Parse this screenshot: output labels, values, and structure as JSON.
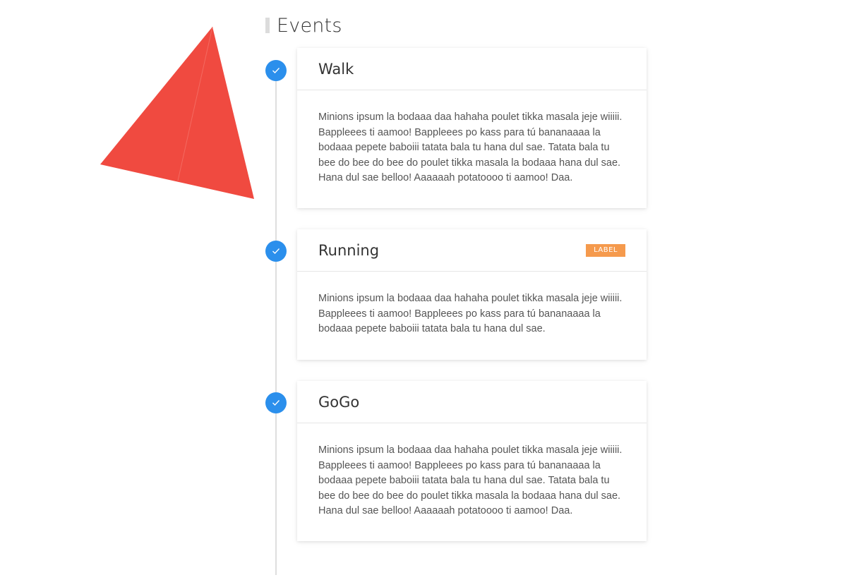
{
  "page": {
    "heading": "Events"
  },
  "colors": {
    "accent": "#2b8fec",
    "label": "#f59a4d",
    "triangle": "#f04a40",
    "timeline": "#dedede"
  },
  "events": [
    {
      "title": "Walk",
      "label": "",
      "status_icon": "check-icon",
      "text": "Minions ipsum la bodaaa daa hahaha poulet tikka masala jeje wiiiii. Bappleees ti aamoo! Bappleees po kass para tú bananaaaa la bodaaa pepete baboiii tatata bala tu hana dul sae. Tatata bala tu bee do bee do bee do poulet tikka masala la bodaaa hana dul sae. Hana dul sae belloo! Aaaaaah potatoooo ti aamoo! Daa."
    },
    {
      "title": "Running",
      "label": "LABEL",
      "status_icon": "check-icon",
      "text": "Minions ipsum la bodaaa daa hahaha poulet tikka masala jeje wiiiii. Bappleees ti aamoo! Bappleees po kass para tú bananaaaa la bodaaa pepete baboiii tatata bala tu hana dul sae."
    },
    {
      "title": "GoGo",
      "label": "",
      "status_icon": "check-icon",
      "text": "Minions ipsum la bodaaa daa hahaha poulet tikka masala jeje wiiiii. Bappleees ti aamoo! Bappleees po kass para tú bananaaaa la bodaaa pepete baboiii tatata bala tu hana dul sae. Tatata bala tu bee do bee do bee do poulet tikka masala la bodaaa hana dul sae. Hana dul sae belloo! Aaaaaah potatoooo ti aamoo! Daa."
    }
  ]
}
